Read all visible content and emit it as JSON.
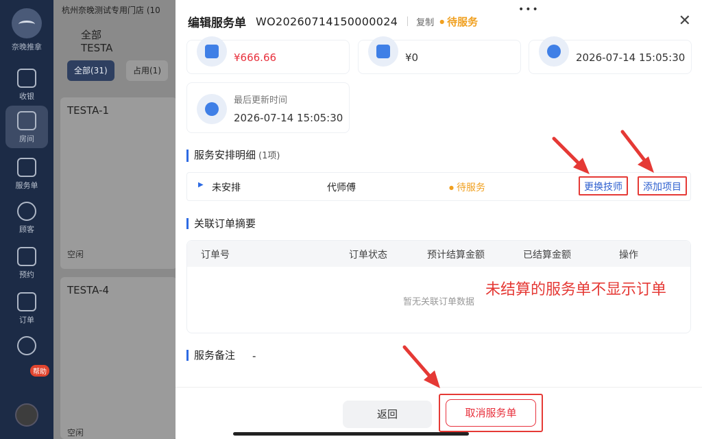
{
  "nav": {
    "logo_text": "奈晚推拿",
    "items": [
      {
        "label": "收银",
        "icon": "cashier-icon"
      },
      {
        "label": "房间",
        "icon": "home-icon"
      },
      {
        "label": "服务单",
        "icon": "service-order-icon"
      },
      {
        "label": "顾客",
        "icon": "customer-icon"
      },
      {
        "label": "预约",
        "icon": "calendar-icon"
      },
      {
        "label": "订单",
        "icon": "order-icon"
      },
      {
        "label": "",
        "icon": "staff-icon"
      }
    ],
    "active": "房间",
    "help_badge": "帮助"
  },
  "behind": {
    "store_name": "杭州奈晚测试专用门店 (10",
    "tabs": [
      "全部",
      "TESTA"
    ],
    "chips": [
      "全部(31)",
      "占用(1)"
    ],
    "cards": [
      {
        "title": "TESTA-1",
        "status": "空闲"
      },
      {
        "title": "TESTA-4",
        "status": "空闲"
      }
    ]
  },
  "header": {
    "title": "编辑服务单",
    "order_code": "WO20260714150000024",
    "copy_label": "复制",
    "status": "待服务"
  },
  "stats": {
    "amount_red": "¥666.66",
    "amount_zero": "¥0",
    "created_time": "2026-07-14 15:05:30",
    "last_update_label": "最后更新时间",
    "last_update_time": "2026-07-14 15:05:30"
  },
  "service_detail": {
    "title": "服务安排明细",
    "count": "(1项)",
    "row": {
      "arrangement": "未安排",
      "technician": "代师傅",
      "status": "待服务"
    },
    "change_tech_label": "更换技师",
    "add_item_label": "添加项目"
  },
  "related_orders": {
    "title": "关联订单摘要",
    "columns": [
      "订单号",
      "订单状态",
      "预计结算金额",
      "已结算金额",
      "操作"
    ],
    "empty_text": "暂无关联订单数据"
  },
  "remark": {
    "title": "服务备注",
    "value": "-"
  },
  "footer": {
    "back_label": "返回",
    "cancel_label": "取消服务单"
  },
  "annotation": "未结算的服务单不显示订单",
  "colors": {
    "accent": "#2d6ae3",
    "warning": "#f0a020",
    "danger": "#e8303c",
    "nav_bg": "#1c2b46"
  }
}
